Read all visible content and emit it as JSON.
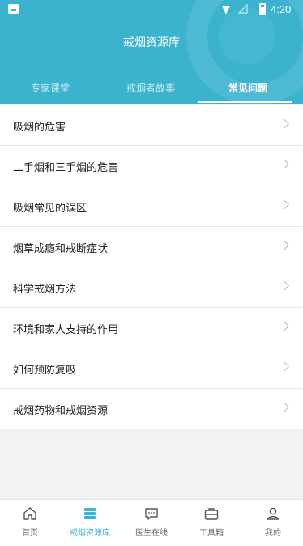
{
  "statusbar": {
    "time": "4:20"
  },
  "header": {
    "title": "戒烟资源库",
    "tabs": [
      {
        "label": "专家课堂",
        "selected": false
      },
      {
        "label": "戒烟者故事",
        "selected": false
      },
      {
        "label": "常见问题",
        "selected": true
      }
    ]
  },
  "list": {
    "items": [
      {
        "label": "吸烟的危害"
      },
      {
        "label": "二手烟和三手烟的危害"
      },
      {
        "label": "吸烟常见的误区"
      },
      {
        "label": "烟草成瘾和戒断症状"
      },
      {
        "label": "科学戒烟方法"
      },
      {
        "label": "环境和家人支持的作用"
      },
      {
        "label": "如何预防复吸"
      },
      {
        "label": "戒烟药物和戒烟资源"
      }
    ]
  },
  "bottom_nav": {
    "items": [
      {
        "label": "首页",
        "icon": "home-icon",
        "active": false
      },
      {
        "label": "戒烟资源库",
        "icon": "library-icon",
        "active": true
      },
      {
        "label": "医生在线",
        "icon": "chat-icon",
        "active": false
      },
      {
        "label": "工具箱",
        "icon": "toolbox-icon",
        "active": false
      },
      {
        "label": "我的",
        "icon": "profile-icon",
        "active": false
      }
    ]
  },
  "colors": {
    "primary": "#3bb3cf",
    "text": "#222222",
    "inactive": "#666666"
  }
}
